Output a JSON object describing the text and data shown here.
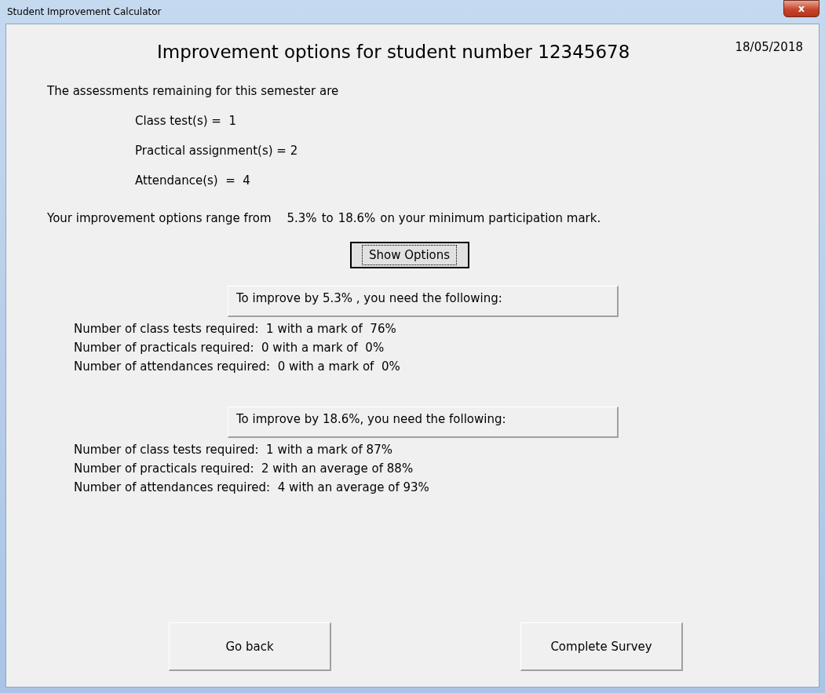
{
  "window": {
    "title": "Student Improvement Calculator",
    "close": "x"
  },
  "heading": "Improvement options for student number 12345678",
  "date": "18/05/2018",
  "intro": "The assessments remaining for this semester are",
  "assessments": [
    "Class test(s) =  1",
    "Practical assignment(s) = 2",
    "Attendance(s)  =  4"
  ],
  "range": {
    "prefix": "Your improvement options range from",
    "low": "5.3%",
    "middle": "to",
    "high": "18.6%",
    "suffix": "on your minimum participation mark."
  },
  "show_options": {
    "label": "Show Options",
    "focused": true
  },
  "options": [
    {
      "header": "To improve by 5.3% , you need the following:",
      "lines": [
        "Number of class tests required:  1 with a mark of  76%",
        "Number of practicals required:  0 with a mark of  0%",
        "Number of attendances required:  0 with a mark of  0%"
      ]
    },
    {
      "header": "To improve by 18.6%, you need the following:",
      "lines": [
        "Number of class tests required:  1 with a mark of 87%",
        "Number of practicals required:  2 with an average of 88%",
        "Number of attendances required:  4 with an average of 93%"
      ]
    }
  ],
  "buttons": [
    "Go back",
    "Complete Survey"
  ]
}
